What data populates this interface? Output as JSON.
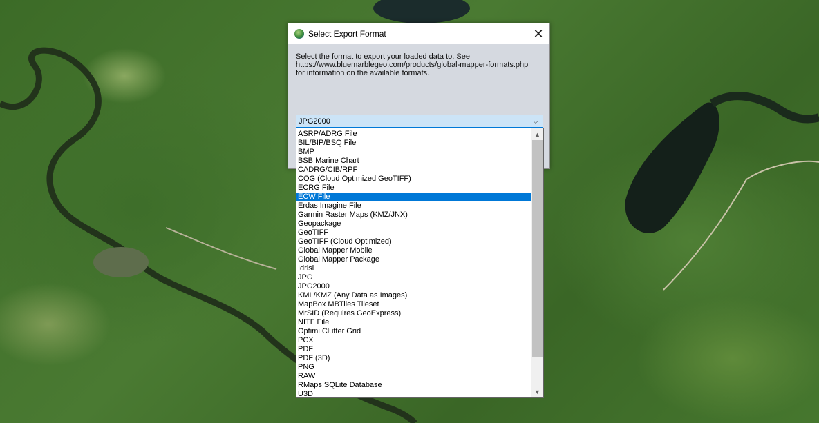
{
  "dialog": {
    "title": "Select Export Format",
    "close_glyph": "✕",
    "description_lines": [
      "Select the format to export your loaded data to. See",
      "https://www.bluemarblegeo.com/products/global-mapper-formats.php",
      "for information on the available formats."
    ]
  },
  "select": {
    "value": "JPG2000",
    "arrow_glyph": "⌵"
  },
  "dropdown": {
    "items": [
      "ASRP/ADRG File",
      "BIL/BIP/BSQ File",
      "BMP",
      "BSB Marine Chart",
      "CADRG/CIB/RPF",
      "COG (Cloud Optimized GeoTIFF)",
      "ECRG File",
      "ECW File",
      "Erdas Imagine File",
      "Garmin Raster Maps (KMZ/JNX)",
      "Geopackage",
      "GeoTIFF",
      "GeoTIFF (Cloud Optimized)",
      "Global Mapper Mobile",
      "Global Mapper Package",
      "Idrisi",
      "JPG",
      "JPG2000",
      "KML/KMZ (Any Data as Images)",
      "MapBox MBTiles Tileset",
      "MrSID (Requires GeoExpress)",
      "NITF File",
      "Optimi Clutter Grid",
      "PCX",
      "PDF",
      "PDF (3D)",
      "PNG",
      "RAW",
      "RMaps SQLite Database",
      "U3D"
    ],
    "highlighted_index": 7,
    "scroll_up_glyph": "▲",
    "scroll_down_glyph": "▼"
  },
  "colors": {
    "highlight": "#0078d7",
    "dialog_body": "#d5d9e0",
    "select_bg": "#cce4f7"
  }
}
